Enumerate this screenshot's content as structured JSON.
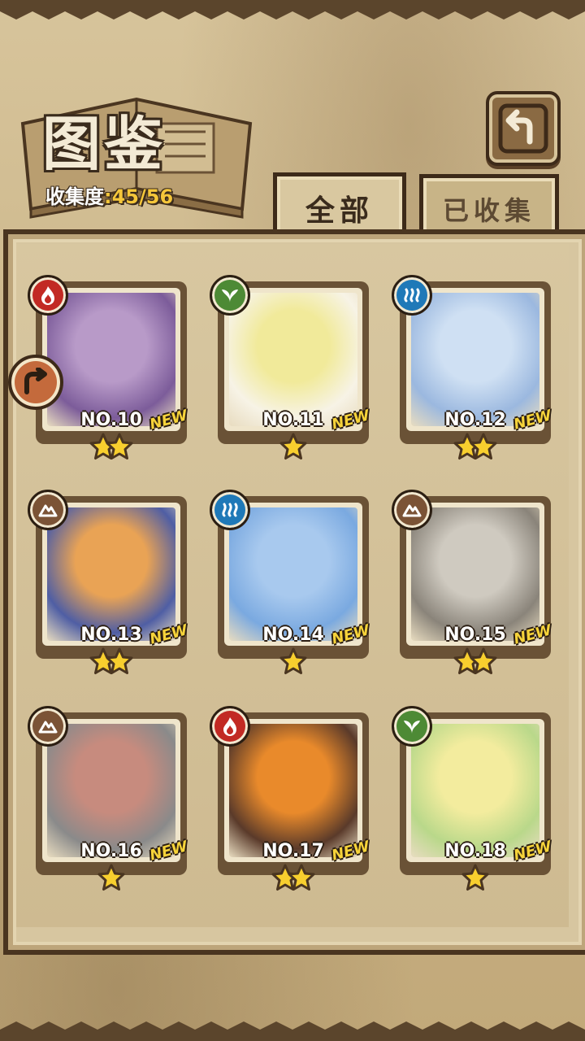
{
  "header": {
    "title": "图鉴",
    "collection_label": "收集度",
    "collection_sep": ":",
    "collection_count": "45/56",
    "back_icon": "back-arrow-icon"
  },
  "tabs": [
    {
      "label": "全部",
      "active": true
    },
    {
      "label": "已收集",
      "active": false
    }
  ],
  "side_button_icon": "arrow-icon",
  "colors": {
    "fire": "#c22a24",
    "leaf": "#4d8a35",
    "water": "#1f79b8",
    "earth": "#7b5336",
    "new_text": "#f6d33a",
    "count_text": "#f5c63a"
  },
  "cards": [
    {
      "no": "NO.10",
      "element": "fire",
      "stars": 2,
      "new": "NEW",
      "art": [
        "#b89ac8",
        "#7c5c9a"
      ]
    },
    {
      "no": "NO.11",
      "element": "leaf",
      "stars": 1,
      "new": "NEW",
      "art": [
        "#f1ea9a",
        "#f7f3e6"
      ]
    },
    {
      "no": "NO.12",
      "element": "water",
      "stars": 2,
      "new": "NEW",
      "art": [
        "#cfe0f3",
        "#9bb8df"
      ]
    },
    {
      "no": "NO.13",
      "element": "earth",
      "stars": 2,
      "new": "NEW",
      "art": [
        "#e9a355",
        "#4f5ea4"
      ]
    },
    {
      "no": "NO.14",
      "element": "water",
      "stars": 1,
      "new": "NEW",
      "art": [
        "#a8c9ee",
        "#7aa9e0"
      ]
    },
    {
      "no": "NO.15",
      "element": "earth",
      "stars": 2,
      "new": "NEW",
      "art": [
        "#cfcac0",
        "#8a847a"
      ]
    },
    {
      "no": "NO.16",
      "element": "earth",
      "stars": 1,
      "new": "NEW",
      "art": [
        "#c78b7e",
        "#8a8a8a"
      ]
    },
    {
      "no": "NO.17",
      "element": "fire",
      "stars": 2,
      "new": "NEW",
      "art": [
        "#e98a2b",
        "#5a3a2a"
      ]
    },
    {
      "no": "NO.18",
      "element": "leaf",
      "stars": 1,
      "new": "NEW",
      "art": [
        "#f3ec9e",
        "#b9d88a"
      ]
    }
  ]
}
